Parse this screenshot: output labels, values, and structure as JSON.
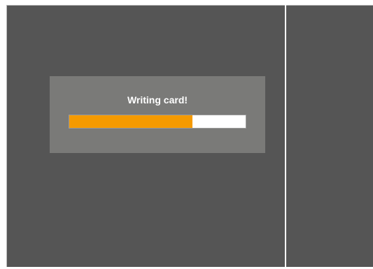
{
  "dialog": {
    "title": "Writing card!",
    "progress": 0.7
  },
  "colors": {
    "background_pane": "#555555",
    "dialog_bg": "#7a7a78",
    "progress_fill": "#f59a00",
    "progress_track": "#ffffff"
  }
}
